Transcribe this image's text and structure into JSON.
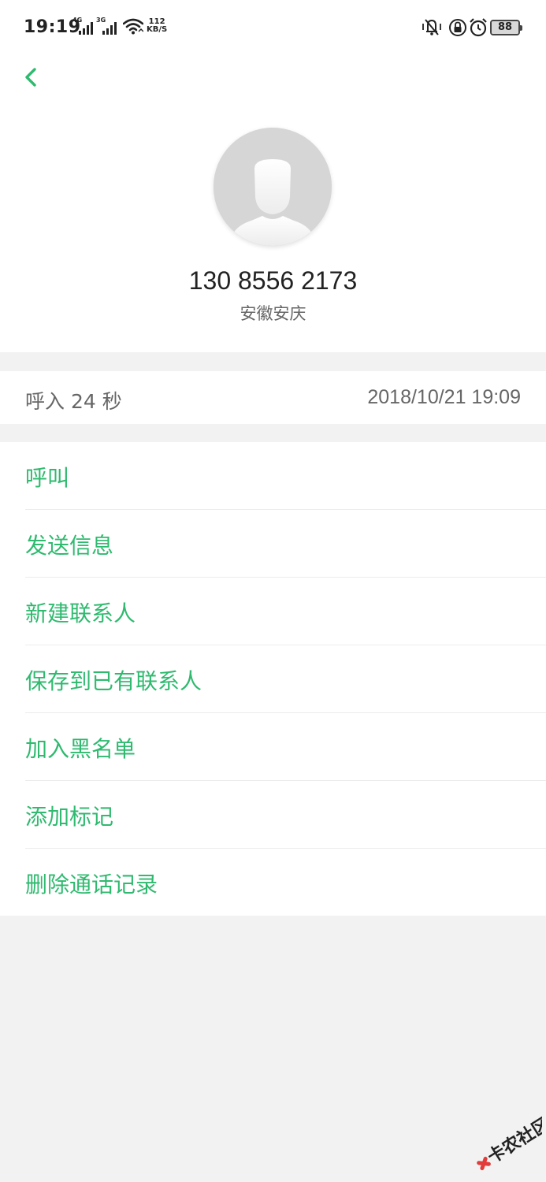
{
  "status_bar": {
    "time": "19:19",
    "network_1": "4G",
    "network_2": "3G",
    "speed_value": "112",
    "speed_unit": "KB/S",
    "battery": "88"
  },
  "header": {
    "back_icon": "chevron-left-icon",
    "avatar_icon": "default-avatar-icon",
    "phone_number": "130 8556 2173",
    "location": "安徽安庆"
  },
  "call_info": {
    "type": "呼入",
    "duration": "24 秒",
    "datetime": "2018/10/21 19:09"
  },
  "actions": [
    {
      "label": "呼叫"
    },
    {
      "label": "发送信息"
    },
    {
      "label": "新建联系人"
    },
    {
      "label": "保存到已有联系人"
    },
    {
      "label": "加入黑名单"
    },
    {
      "label": "添加标记"
    },
    {
      "label": "删除通话记录"
    }
  ],
  "watermark": {
    "text": "卡农社区"
  },
  "colors": {
    "accent": "#2fba6f",
    "background": "#f2f2f2",
    "surface": "#ffffff"
  }
}
